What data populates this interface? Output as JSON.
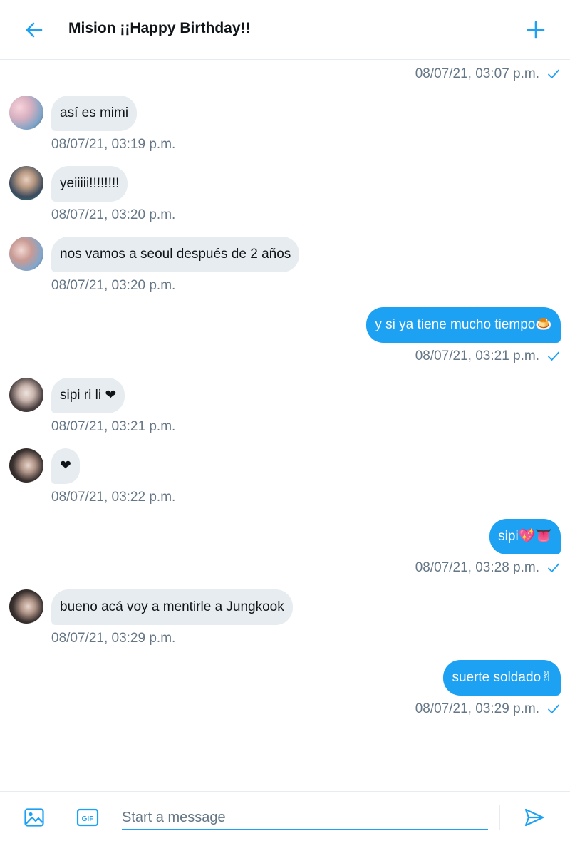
{
  "header": {
    "title": "Mision ¡¡Happy Birthday!!"
  },
  "colors": {
    "accent": "#1da1f2",
    "incoming_bubble": "#e6ecf0",
    "timestamp": "#657786"
  },
  "messages": [
    {
      "direction": "out",
      "text": "",
      "timestamp": "08/07/21, 03:07 p.m.",
      "read": true
    },
    {
      "direction": "in",
      "text": "así es mimi",
      "timestamp": "08/07/21, 03:19 p.m."
    },
    {
      "direction": "in",
      "text": "yeiiiii!!!!!!!!",
      "timestamp": "08/07/21, 03:20 p.m."
    },
    {
      "direction": "in",
      "text": "nos vamos a seoul después de 2 años",
      "timestamp": "08/07/21, 03:20 p.m."
    },
    {
      "direction": "out",
      "text": "y si ya tiene mucho tiempo🍮",
      "timestamp": "08/07/21, 03:21 p.m.",
      "read": true
    },
    {
      "direction": "in",
      "text": "sipi ri li ❤",
      "timestamp": "08/07/21, 03:21 p.m."
    },
    {
      "direction": "in",
      "text": "❤",
      "timestamp": "08/07/21, 03:22 p.m."
    },
    {
      "direction": "out",
      "text": "sipi💖👅",
      "timestamp": "08/07/21, 03:28 p.m.",
      "read": true
    },
    {
      "direction": "in",
      "text": "bueno acá voy a mentirle a Jungkook",
      "timestamp": "08/07/21, 03:29 p.m."
    },
    {
      "direction": "out",
      "text": "suerte soldado✌",
      "timestamp": "08/07/21, 03:29 p.m.",
      "read": true
    }
  ],
  "composer": {
    "placeholder": "Start a message",
    "value": "",
    "icons": [
      "image-icon",
      "gif-icon",
      "send-icon"
    ]
  }
}
